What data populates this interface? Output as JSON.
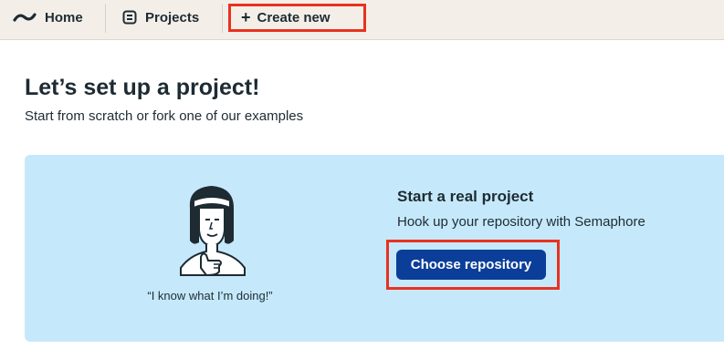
{
  "nav": {
    "home_label": "Home",
    "projects_label": "Projects",
    "create_label": "Create new",
    "create_symbol": "+"
  },
  "page": {
    "title": "Let’s set up a project!",
    "subtitle": "Start from scratch or fork one of our examples"
  },
  "card": {
    "quote": "“I know what I’m doing!”",
    "option_title": "Start a real project",
    "option_desc": "Hook up your repository with Semaphore",
    "button_label": "Choose repository"
  },
  "colors": {
    "topbar_bg": "#f3efe8",
    "card_bg": "#c5e9fb",
    "button_bg": "#0b3e99",
    "highlight": "#e8321f",
    "text": "#1e2b33"
  },
  "icons": {
    "home": "semaphore-logo-icon",
    "projects": "projects-icon",
    "create": "plus-icon"
  }
}
